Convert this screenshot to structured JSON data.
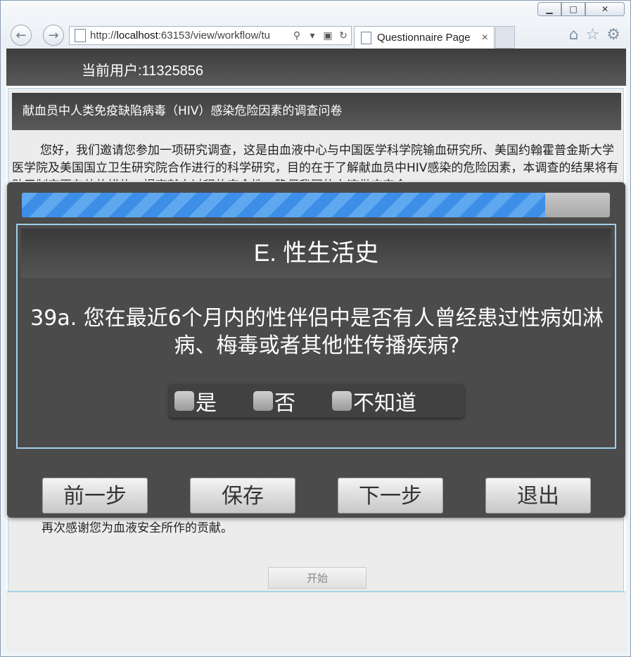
{
  "browser": {
    "address_prefix": "http://",
    "address_host": "localhost",
    "address_rest": ":63153/view/workflow/tu",
    "tab_title": "Questionnaire Page",
    "tab_close": "×",
    "min_glyph": "▁",
    "max_glyph": "□",
    "close_glyph": "✕"
  },
  "header": {
    "current_user": "当前用户:11325856"
  },
  "survey": {
    "title": "献血员中人类免疫缺陷病毒（HIV）感染危险因素的调查问卷",
    "intro": "您好，我们邀请您参加一项研究调查，这是由血液中心与中国医学科学院输血研究所、美国约翰霍普金斯大学医学院及美国国立卫生研究院合作进行的科学研究，目的在于了解献血员中HIV感染的危险因素，本调查的结果将有助于制定更有效的措施，提高献血过程的安全性，确保我国的血液供应安全。",
    "thanks": "再次感谢您为血液安全所作的贡献。",
    "start_label": "开始"
  },
  "modal": {
    "progress": 0.89,
    "section_title": "E. 性生活史",
    "question": "39a. 您在最近6个月内的性伴侣中是否有人曾经患过性病如淋病、梅毒或者其他性传播疾病?",
    "options": [
      "是",
      "否",
      "不知道"
    ],
    "buttons": {
      "prev": "前一步",
      "save": "保存",
      "next": "下一步",
      "exit": "退出"
    }
  }
}
